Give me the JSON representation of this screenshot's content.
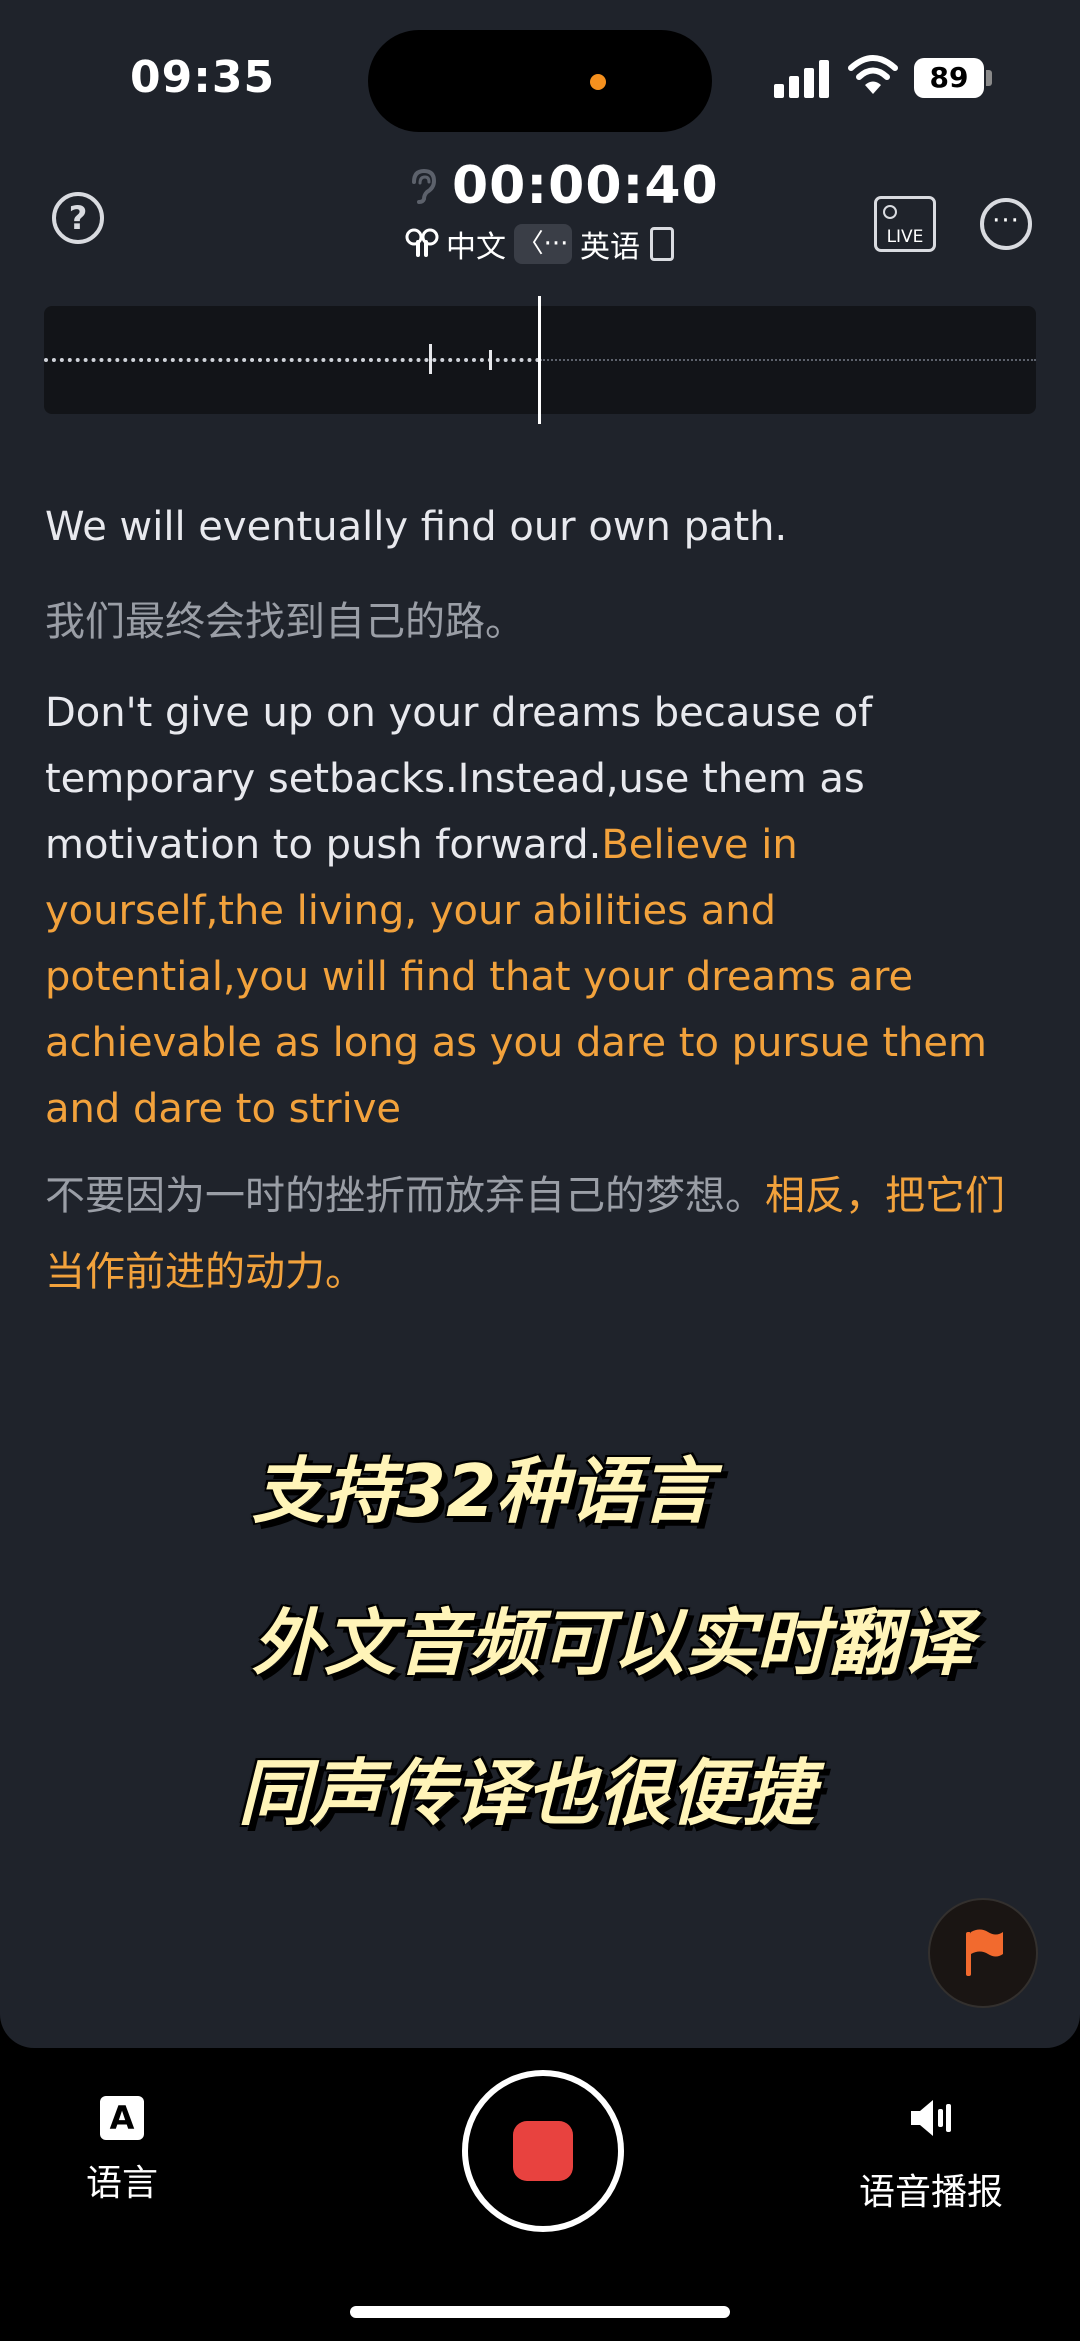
{
  "status_bar": {
    "time": "09:35",
    "battery": "89"
  },
  "header": {
    "timer": "00:00:40",
    "source_lang": "中文",
    "swap_label": "〈···",
    "target_lang": "英语",
    "live_label": "LIVE",
    "help_label": "?",
    "more_label": "···"
  },
  "transcript": {
    "p1_en": "We will eventually find our own path.",
    "p1_zh": "我们最终会找到自己的路。",
    "p2_en": "Don't give up on your dreams because of temporary setbacks.Instead,use them as motivation to push forward.",
    "p2_en_live": "Believe in yourself,the living, your abilities and potential,you will find that your dreams are achievable as long as you dare to pursue them and dare to strive",
    "p2_zh": "不要因为一时的挫折而放弃自己的梦想。",
    "p2_zh_live": "相反，把它们当作前进的动力。"
  },
  "overlay_caption": {
    "line1": "支持32种语言",
    "line2": "外文音频可以实时翻译",
    "line3": "同声传译也很便捷"
  },
  "bottom_bar": {
    "language_tab": "语言",
    "language_icon_letter": "A",
    "voice_tab": "语音播报"
  },
  "colors": {
    "accent_orange": "#f2a23c",
    "record_red": "#e8423f",
    "background": "#1f232b"
  }
}
